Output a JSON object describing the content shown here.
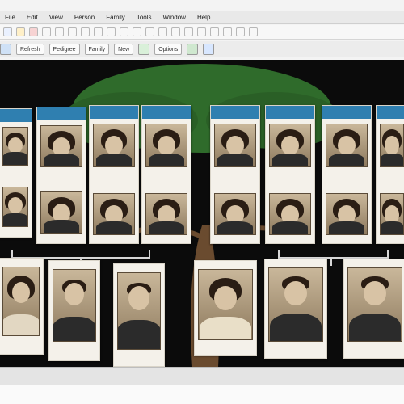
{
  "menu": [
    "File",
    "Edit",
    "View",
    "Person",
    "Family",
    "Tools",
    "Window",
    "Help"
  ],
  "toolbar1": [
    "",
    "",
    "",
    "",
    "",
    "",
    "",
    "",
    "",
    "",
    "",
    "",
    "",
    "",
    "",
    "",
    "",
    "",
    "",
    ""
  ],
  "toolbar2": {
    "buttons": [
      "Refresh",
      "Pedigree",
      "Family",
      "New",
      "Options"
    ]
  },
  "colors": {
    "header_blue": "#2f7fb0",
    "canvas_bg": "#0b0b0b",
    "leaf_green": "#2f6b2b",
    "trunk_brown": "#6a4b2f"
  },
  "tree": {
    "top_row": [
      {
        "id": "p1",
        "header": "",
        "name": ""
      },
      {
        "id": "p2",
        "header": "",
        "name": ""
      },
      {
        "id": "p3",
        "header": "",
        "name": ""
      },
      {
        "id": "p4",
        "header": "",
        "name": ""
      },
      {
        "id": "p5",
        "header": "",
        "name": ""
      },
      {
        "id": "p6",
        "header": "",
        "name": ""
      },
      {
        "id": "p7",
        "header": "",
        "name": ""
      },
      {
        "id": "p8",
        "header": "",
        "name": ""
      },
      {
        "id": "p9",
        "header": "",
        "name": ""
      }
    ],
    "bottom_row": [
      {
        "id": "c1",
        "header": "",
        "name": ""
      },
      {
        "id": "c2",
        "header": "",
        "name": ""
      },
      {
        "id": "c3",
        "header": "",
        "name": ""
      },
      {
        "id": "c4",
        "header": "",
        "name": ""
      },
      {
        "id": "c5",
        "header": "",
        "name": ""
      },
      {
        "id": "c6",
        "header": "",
        "name": ""
      }
    ]
  }
}
